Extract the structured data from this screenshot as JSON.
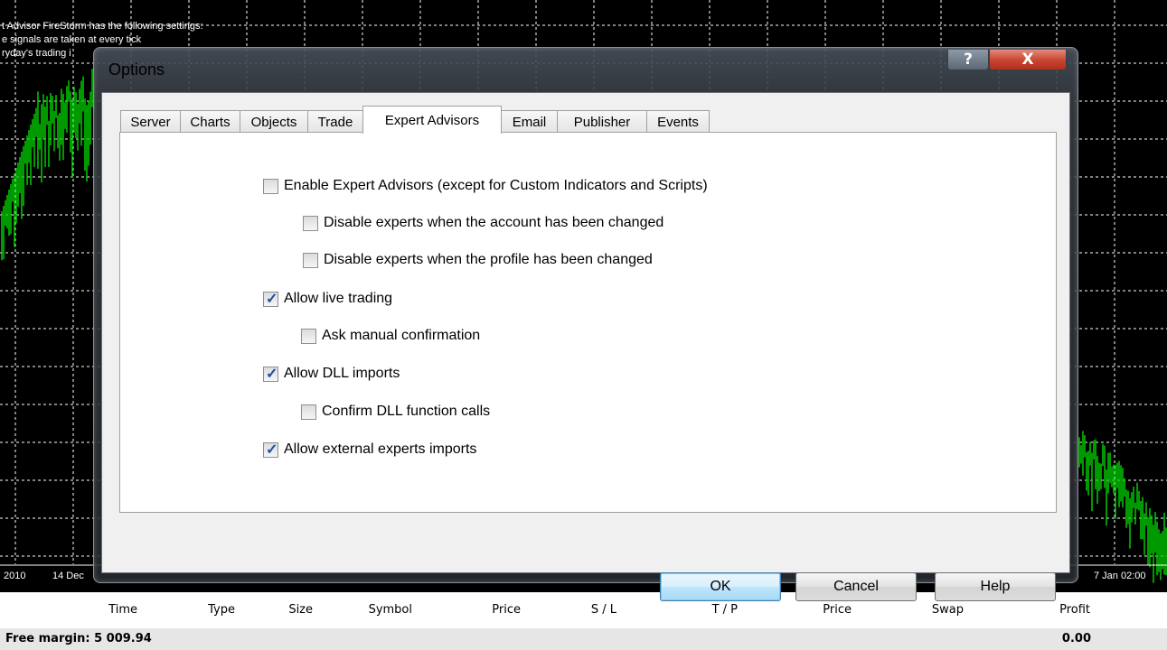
{
  "chart": {
    "ea_text_lines": [
      "t Advisor FireStorm has the following settings:",
      "e signals are taken at every tick",
      "ryday's trading i"
    ],
    "date_left": "2010",
    "date_left2": "14 Dec",
    "date_right": "7 Jan 02:00"
  },
  "dialog": {
    "title": "Options",
    "help_glyph": "?",
    "close_glyph": "X",
    "tabs": [
      "Server",
      "Charts",
      "Objects",
      "Trade",
      "Expert Advisors",
      "Email",
      "Publisher",
      "Events"
    ],
    "active_tab": "Expert Advisors",
    "options": [
      {
        "label": "Enable Expert Advisors (except for Custom Indicators and Scripts)",
        "checked": false
      },
      {
        "label": "Disable experts when the account has been changed",
        "checked": false
      },
      {
        "label": "Disable experts when the profile has been changed",
        "checked": false
      },
      {
        "label": "Allow live trading",
        "checked": true
      },
      {
        "label": "Ask manual confirmation",
        "checked": false
      },
      {
        "label": "Allow DLL imports",
        "checked": true
      },
      {
        "label": "Confirm DLL function calls",
        "checked": false
      },
      {
        "label": "Allow external experts imports",
        "checked": true
      }
    ],
    "check_glyph": "✓",
    "buttons": {
      "ok": "OK",
      "cancel": "Cancel",
      "help": "Help"
    }
  },
  "terminal": {
    "columns": [
      "Time",
      "Type",
      "Size",
      "Symbol",
      "Price",
      "S / L",
      "T / P",
      "Price",
      "Swap",
      "Profit"
    ],
    "free_margin": "Free margin: 5 009.94",
    "profit_total": "0.00"
  },
  "colors": {
    "candle": "#00cc00",
    "grid": "#ffffff",
    "accent": "#3c7fb1",
    "checkmark": "#1b4fa8"
  }
}
